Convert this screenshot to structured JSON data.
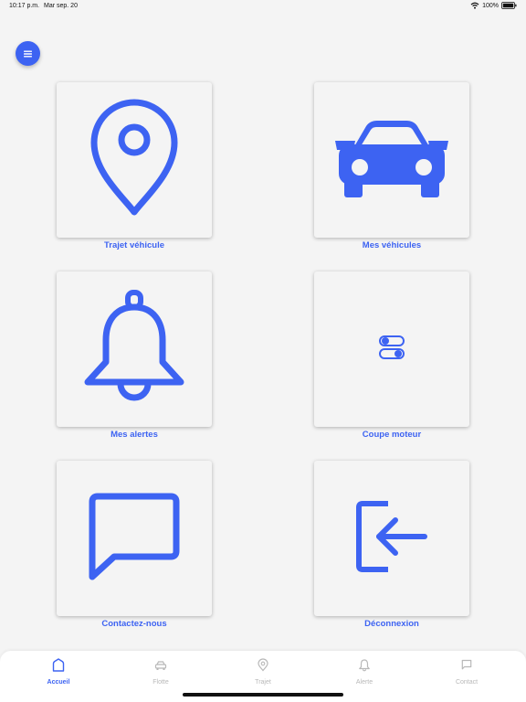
{
  "status": {
    "time": "10:17 p.m.",
    "date": "Mar sep. 20",
    "battery": "100%"
  },
  "menu": {
    "icon": "hamburger-icon"
  },
  "tiles": [
    {
      "label": "Trajet véhicule",
      "icon": "map-pin-icon"
    },
    {
      "label": "Mes véhicules",
      "icon": "car-icon"
    },
    {
      "label": "Mes alertes",
      "icon": "bell-icon"
    },
    {
      "label": "Coupe moteur",
      "icon": "toggles-icon"
    },
    {
      "label": "Contactez-nous",
      "icon": "chat-bubble-icon"
    },
    {
      "label": "Déconnexion",
      "icon": "logout-icon"
    }
  ],
  "tabbar": {
    "items": [
      {
        "label": "Accueil",
        "icon": "home-icon",
        "active": true
      },
      {
        "label": "Flotte",
        "icon": "car-icon"
      },
      {
        "label": "Trajet",
        "icon": "map-pin-icon"
      },
      {
        "label": "Alerte",
        "icon": "bell-icon"
      },
      {
        "label": "Contact",
        "icon": "chat-bubble-icon"
      }
    ]
  },
  "colors": {
    "accent": "#3d63f2",
    "background": "#f4f4f4",
    "inactive": "#b8b8b8"
  }
}
